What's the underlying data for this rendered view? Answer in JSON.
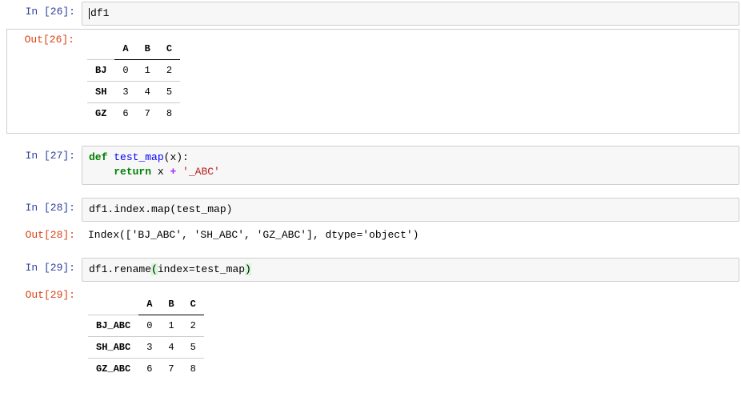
{
  "cells": {
    "c1": {
      "in_prompt": "In  [26]:",
      "out_prompt": "Out[26]:",
      "code": "df1"
    },
    "c2": {
      "in_prompt": "In  [27]:",
      "code_def": "def",
      "code_fn": "test_map",
      "code_args": "(x):",
      "code_return": "return",
      "code_expr1": " x ",
      "code_op": "+",
      "code_str": " '_ABC'"
    },
    "c3": {
      "in_prompt": "In  [28]:",
      "out_prompt": "Out[28]:",
      "code": "df1.index.map(test_map)",
      "output": "Index(['BJ_ABC', 'SH_ABC', 'GZ_ABC'], dtype='object')"
    },
    "c4": {
      "in_prompt": "In  [29]:",
      "out_prompt": "Out[29]:",
      "code_pre": "df1.rename",
      "code_lp": "(",
      "code_mid": "index=test_map",
      "code_rp": ")"
    }
  },
  "chart_data": [
    {
      "type": "table",
      "title": "df1",
      "columns": [
        "",
        "A",
        "B",
        "C"
      ],
      "rows": [
        {
          "label": "BJ",
          "values": [
            0,
            1,
            2
          ]
        },
        {
          "label": "SH",
          "values": [
            3,
            4,
            5
          ]
        },
        {
          "label": "GZ",
          "values": [
            6,
            7,
            8
          ]
        }
      ]
    },
    {
      "type": "table",
      "title": "df1.rename(index=test_map)",
      "columns": [
        "",
        "A",
        "B",
        "C"
      ],
      "rows": [
        {
          "label": "BJ_ABC",
          "values": [
            0,
            1,
            2
          ]
        },
        {
          "label": "SH_ABC",
          "values": [
            3,
            4,
            5
          ]
        },
        {
          "label": "GZ_ABC",
          "values": [
            6,
            7,
            8
          ]
        }
      ]
    }
  ]
}
